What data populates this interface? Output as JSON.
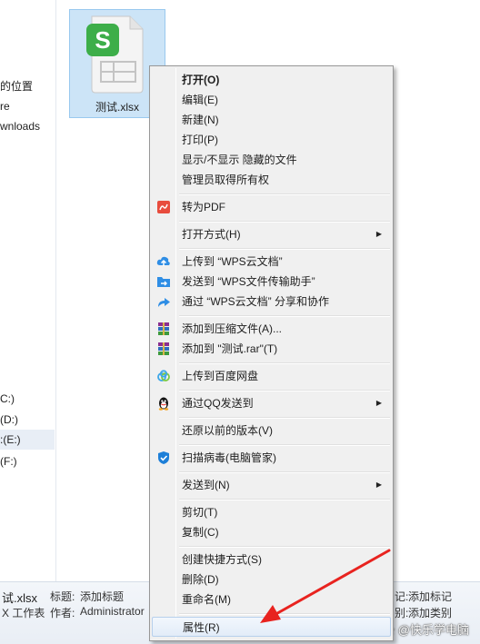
{
  "nav": {
    "items": [
      "的位置",
      "re",
      "wnloads",
      "C:)",
      "(D:)",
      ":(E:)",
      "(F:)"
    ]
  },
  "file": {
    "name": "测试.xlsx",
    "icon_letter": "S"
  },
  "context_menu": {
    "items": [
      {
        "label": "打开(O)",
        "bold": true
      },
      {
        "label": "编辑(E)"
      },
      {
        "label": "新建(N)"
      },
      {
        "label": "打印(P)"
      },
      {
        "label": "显示/不显示 隐藏的文件"
      },
      {
        "label": "管理员取得所有权"
      },
      {
        "label": "转为PDF",
        "icon": "pdf-convert-icon"
      },
      {
        "label": "打开方式(H)",
        "submenu": true
      },
      {
        "label": "上传到 “WPS云文档”",
        "icon": "cloud-upload-icon"
      },
      {
        "label": "发送到 “WPS文件传输助手”",
        "icon": "send-folder-icon"
      },
      {
        "label": "通过 “WPS云文档” 分享和协作",
        "icon": "share-arrow-icon"
      },
      {
        "label": "添加到压缩文件(A)...",
        "icon": "winrar-icon"
      },
      {
        "label": "添加到 \"测试.rar\"(T)",
        "icon": "winrar-icon"
      },
      {
        "label": "上传到百度网盘",
        "icon": "baidu-netdisk-icon"
      },
      {
        "label": "通过QQ发送到",
        "icon": "qq-penguin-icon",
        "submenu": true
      },
      {
        "label": "还原以前的版本(V)"
      },
      {
        "label": "扫描病毒(电脑管家)",
        "icon": "shield-icon"
      },
      {
        "label": "发送到(N)",
        "submenu": true
      },
      {
        "label": "剪切(T)"
      },
      {
        "label": "复制(C)"
      },
      {
        "label": "创建快捷方式(S)"
      },
      {
        "label": "删除(D)"
      },
      {
        "label": "重命名(M)"
      },
      {
        "label": "属性(R)",
        "highlighted": true
      }
    ],
    "submenu_arrow": "▶"
  },
  "details": {
    "file_name": "试.xlsx",
    "file_type": "X 工作表",
    "title_label": "标题:",
    "title_value": "添加标题",
    "author_label": "作者:",
    "author_value": "Administrator",
    "tags_label": "记:",
    "tags_value": "添加标记",
    "category_label": "别:",
    "category_value": "添加类别"
  },
  "watermark": "头条 @快乐学电脑",
  "colors": {
    "wps_green": "#3dae49",
    "arrow_red": "#e8231f",
    "selection_blue": "#cce4f7"
  }
}
